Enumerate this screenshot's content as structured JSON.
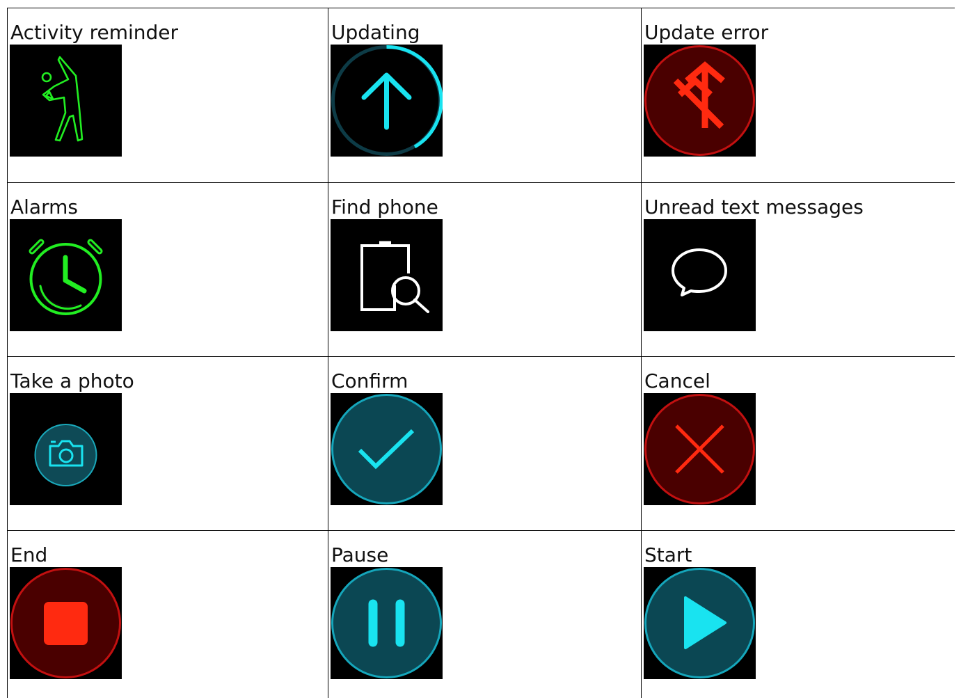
{
  "icons": [
    {
      "label": "Activity reminder",
      "icon": "activity-reminder-icon",
      "color": "#22ee22"
    },
    {
      "label": "Updating",
      "icon": "updating-icon",
      "color": "#19e3f0"
    },
    {
      "label": "Update error",
      "icon": "update-error-icon",
      "color": "#ff2a10"
    },
    {
      "label": "Alarms",
      "icon": "alarm-icon",
      "color": "#22ee22"
    },
    {
      "label": "Find phone",
      "icon": "find-phone-icon",
      "color": "#ffffff"
    },
    {
      "label": "Unread text messages",
      "icon": "message-icon",
      "color": "#ffffff"
    },
    {
      "label": "Take a photo",
      "icon": "camera-icon",
      "color": "#19e3f0"
    },
    {
      "label": "Confirm",
      "icon": "confirm-icon",
      "color": "#19e3f0"
    },
    {
      "label": "Cancel",
      "icon": "cancel-icon",
      "color": "#ff2a10"
    },
    {
      "label": "End",
      "icon": "end-icon",
      "color": "#ff2a10"
    },
    {
      "label": "Pause",
      "icon": "pause-icon",
      "color": "#19e3f0"
    },
    {
      "label": "Start",
      "icon": "start-icon",
      "color": "#19e3f0"
    }
  ]
}
